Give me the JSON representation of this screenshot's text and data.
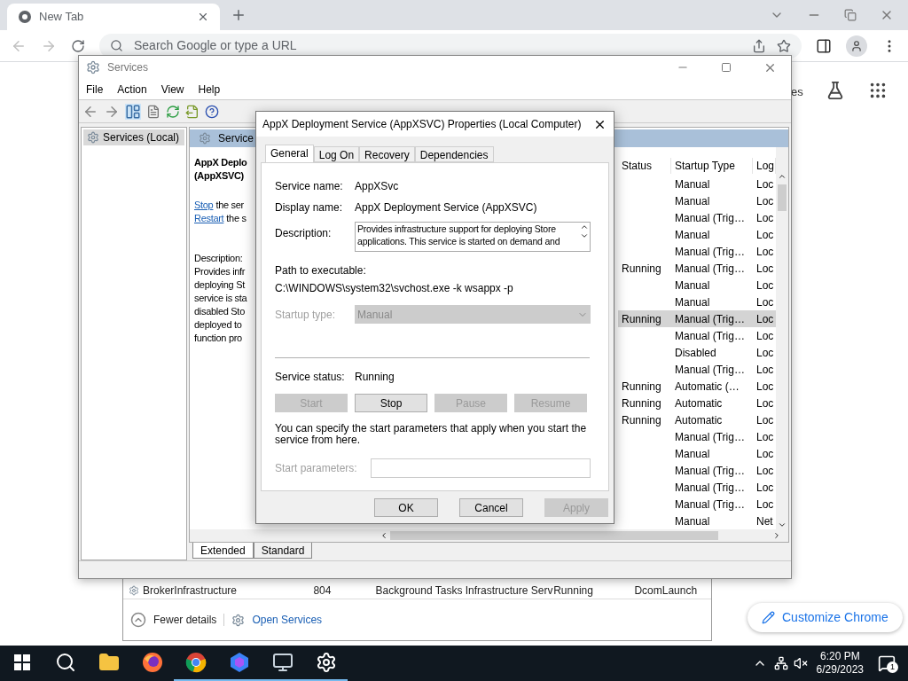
{
  "browser": {
    "tab": {
      "title": "New Tab"
    },
    "omnibox": {
      "placeholder": "Search Google or type a URL"
    },
    "page_link": "es",
    "customize_button": "Customize Chrome"
  },
  "task_manager": {
    "rows": [
      {
        "name": "BrokerInfrastructure",
        "pid": "804",
        "description": "Background Tasks Infrastructure Serv",
        "status": "Running",
        "group": "DcomLaunch"
      }
    ],
    "fewer_details": "Fewer details",
    "open_services": "Open Services"
  },
  "services_window": {
    "title": "Services",
    "menu": [
      "File",
      "Action",
      "View",
      "Help"
    ],
    "tree": [
      {
        "label": "Services (Local)",
        "selected": true
      }
    ],
    "panel_header": "Service",
    "extended": {
      "title_lines": [
        "AppX Deplo",
        "(AppXSVC)"
      ],
      "links": [
        {
          "link": "Stop",
          "rest": "the ser"
        },
        {
          "link": "Restart",
          "rest": "the s"
        }
      ],
      "description_label": "Description:",
      "description_lines": [
        "Provides infr",
        "deploying St",
        "service is sta",
        "disabled Sto",
        "deployed to",
        "function pro"
      ]
    },
    "columns": [
      "Status",
      "Startup Type",
      "Log"
    ],
    "rows": [
      {
        "startup": "Manual",
        "log_on": "Loc",
        "selected": false
      },
      {
        "startup": "Manual",
        "log_on": "Loc",
        "selected": false
      },
      {
        "startup": "Manual (Trig…",
        "log_on": "Loc",
        "selected": false
      },
      {
        "startup": "Manual",
        "log_on": "Loc",
        "selected": false
      },
      {
        "startup": "Manual (Trig…",
        "log_on": "Loc",
        "selected": false
      },
      {
        "status": "Running",
        "startup": "Manual (Trig…",
        "log_on": "Loc",
        "selected": false
      },
      {
        "startup": "Manual",
        "log_on": "Loc",
        "selected": false
      },
      {
        "startup": "Manual",
        "log_on": "Loc",
        "selected": false
      },
      {
        "status": "Running",
        "startup": "Manual (Trig…",
        "log_on": "Loc",
        "selected": true
      },
      {
        "startup": "Manual (Trig…",
        "log_on": "Loc",
        "selected": false
      },
      {
        "startup": "Disabled",
        "log_on": "Loc",
        "selected": false
      },
      {
        "startup": "Manual (Trig…",
        "log_on": "Loc",
        "selected": false
      },
      {
        "status": "Running",
        "startup": "Automatic (…",
        "log_on": "Loc",
        "selected": false
      },
      {
        "status": "Running",
        "startup": "Automatic",
        "log_on": "Loc",
        "selected": false
      },
      {
        "status": "Running",
        "startup": "Automatic",
        "log_on": "Loc",
        "selected": false
      },
      {
        "startup": "Manual (Trig…",
        "log_on": "Loc",
        "selected": false
      },
      {
        "startup": "Manual",
        "log_on": "Loc",
        "selected": false
      },
      {
        "startup": "Manual (Trig…",
        "log_on": "Loc",
        "selected": false
      },
      {
        "startup": "Manual (Trig…",
        "log_on": "Loc",
        "selected": false
      },
      {
        "startup": "Manual (Trig…",
        "log_on": "Loc",
        "selected": false
      },
      {
        "startup": "Manual",
        "log_on": "Net",
        "selected": false
      }
    ],
    "view_tabs": [
      {
        "label": "Extended",
        "selected": true
      },
      {
        "label": "Standard",
        "selected": false
      }
    ]
  },
  "dialog": {
    "title": "AppX Deployment Service (AppXSVC) Properties (Local Computer)",
    "tabs": [
      {
        "label": "General",
        "selected": true
      },
      {
        "label": "Log On",
        "selected": false
      },
      {
        "label": "Recovery",
        "selected": false
      },
      {
        "label": "Dependencies",
        "selected": false
      }
    ],
    "fields": [
      {
        "label": "Service name:",
        "value": "AppXSvc"
      },
      {
        "label": "Display name:",
        "value": "AppX Deployment Service (AppXSVC)"
      }
    ],
    "description": {
      "label": "Description:",
      "lines": [
        "Provides infrastructure support for deploying Store",
        "applications. This service is started on demand and"
      ]
    },
    "path": {
      "label": "Path to executable:",
      "value": "C:\\WINDOWS\\system32\\svchost.exe -k wsappx -p"
    },
    "startup_type": {
      "label": "Startup type:",
      "value": "Manual",
      "disabled": true
    },
    "service_status": {
      "label": "Service status:",
      "value": "Running"
    },
    "control_buttons": [
      {
        "label": "Start",
        "disabled": true
      },
      {
        "label": "Stop",
        "disabled": false
      },
      {
        "label": "Pause",
        "disabled": true
      },
      {
        "label": "Resume",
        "disabled": true
      }
    ],
    "hint": "You can specify the start parameters that apply when you start the service from here.",
    "start_parameters": {
      "label": "Start parameters:",
      "disabled": true
    },
    "buttons": [
      {
        "label": "OK",
        "disabled": false
      },
      {
        "label": "Cancel",
        "disabled": false
      },
      {
        "label": "Apply",
        "disabled": true
      }
    ]
  },
  "taskbar": {
    "apps": [
      {
        "kind": "start",
        "open": false
      },
      {
        "kind": "search",
        "open": false
      },
      {
        "kind": "explorer",
        "open": false
      },
      {
        "kind": "firefox",
        "open": false
      },
      {
        "kind": "chrome",
        "open": true
      },
      {
        "kind": "copilot",
        "open": true
      },
      {
        "kind": "monitor",
        "open": true
      },
      {
        "kind": "gear",
        "open": true
      }
    ],
    "time": "6:20 PM",
    "date": "6/29/2023",
    "notifications": "1"
  }
}
